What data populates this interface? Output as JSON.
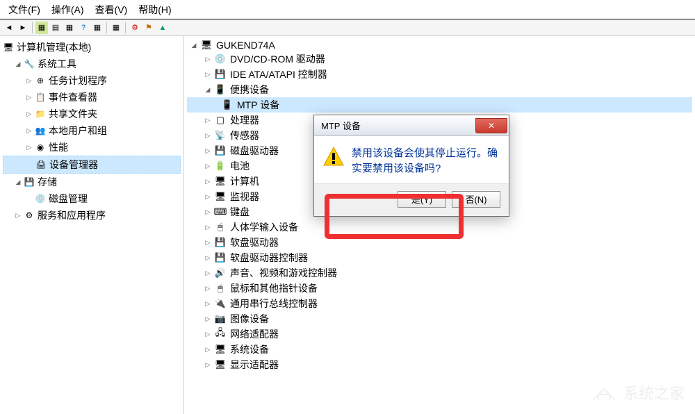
{
  "menubar": {
    "file": "文件(F)",
    "action": "操作(A)",
    "view": "查看(V)",
    "help": "帮助(H)"
  },
  "sidebar": {
    "root": "计算机管理(本地)",
    "system_tools": "系统工具",
    "task_scheduler": "任务计划程序",
    "event_viewer": "事件查看器",
    "shared_folders": "共享文件夹",
    "local_users": "本地用户和组",
    "performance": "性能",
    "device_manager": "设备管理器",
    "storage": "存储",
    "disk_management": "磁盘管理",
    "services_apps": "服务和应用程序"
  },
  "devices": {
    "root": "GUKEND74A",
    "dvd": "DVD/CD-ROM 驱动器",
    "ide": "IDE ATA/ATAPI 控制器",
    "portable": "便携设备",
    "mtp": "MTP 设备",
    "processor": "处理器",
    "sensor": "传感器",
    "disk_drive": "磁盘驱动器",
    "battery": "电池",
    "computer": "计算机",
    "monitor": "监视器",
    "keyboard": "键盘",
    "hid": "人体学输入设备",
    "floppy_drive": "软盘驱动器",
    "floppy_controller": "软盘驱动器控制器",
    "sound": "声音、视频和游戏控制器",
    "mouse": "鼠标和其他指针设备",
    "usb": "通用串行总线控制器",
    "imaging": "图像设备",
    "network": "网络适配器",
    "system": "系统设备",
    "display": "显示适配器"
  },
  "dialog": {
    "title": "MTP 设备",
    "message": "禁用该设备会使其停止运行。确实要禁用该设备吗?",
    "yes": "是(Y)",
    "no": "否(N)"
  },
  "watermark": "系统之家"
}
